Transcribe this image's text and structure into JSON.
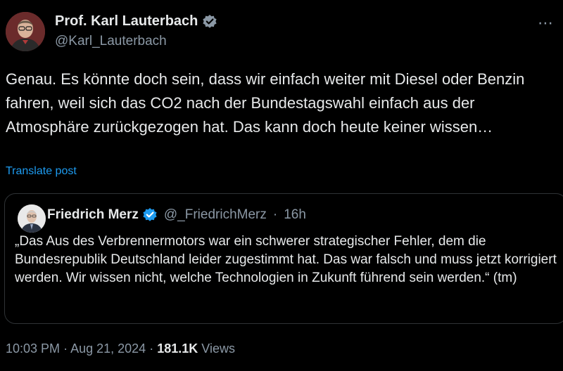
{
  "author": {
    "name": "Prof. Karl Lauterbach",
    "handle": "@Karl_Lauterbach"
  },
  "post": {
    "text": "Genau. Es könnte doch sein, dass wir einfach weiter mit Diesel oder Benzin fahren, weil sich das CO2 nach der Bundestagswahl einfach aus der Atmosphäre zurückgezogen hat. Das kann doch heute keiner wissen…",
    "translate_label": "Translate post"
  },
  "quote": {
    "name": "Friedrich Merz",
    "handle": "@_FriedrichMerz",
    "time": "16h",
    "text": "„Das Aus des Verbrennermotors war ein schwerer strategischer Fehler, dem die Bundesrepublik Deutschland leider zugestimmt hat. Das war falsch und muss jetzt korrigiert werden. Wir wissen nicht, welche Technologien in Zukunft führend sein werden.“ (tm)"
  },
  "footer": {
    "time": "10:03 PM",
    "date": "Aug 21, 2024",
    "views_count": "181.1K",
    "views_label": "Views"
  },
  "colors": {
    "background": "#000000",
    "text": "#e7e9ea",
    "muted": "#8b98a5",
    "link": "#1d9bf0",
    "border": "#2f3336"
  },
  "icons": [
    "verified-badge-icon",
    "more-options-icon"
  ]
}
